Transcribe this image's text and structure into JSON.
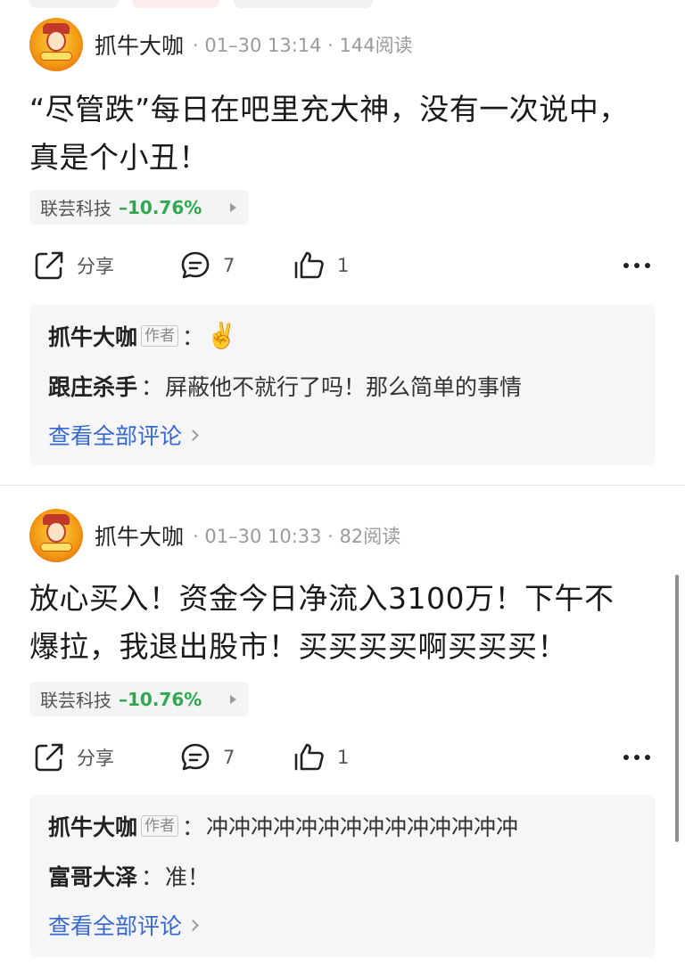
{
  "posts": [
    {
      "author": "抓牛大咖",
      "meta": "· 01–30 13:14 · 144阅读",
      "content_lines": [
        "“尽管跌”每日在吧里充大神，没有一次说中，",
        "真是个小丑！"
      ],
      "stock": {
        "name": "联芸科技",
        "change": "–10.76%"
      },
      "actions": {
        "share_label": "分享",
        "comment_count": "7",
        "like_count": "1"
      },
      "comments": [
        {
          "author": "抓牛大咖",
          "badge": "作者",
          "text": "✌️"
        },
        {
          "author": "跟庄杀手",
          "text": "屏蔽他不就行了吗！那么简单的事情"
        }
      ],
      "view_all": "查看全部评论"
    },
    {
      "author": "抓牛大咖",
      "meta": "· 01–30 10:33 · 82阅读",
      "content_lines": [
        "放心买入！资金今日净流入3100万！下午不",
        "爆拉，我退出股市！买买买买啊买买买！"
      ],
      "stock": {
        "name": "联芸科技",
        "change": "–10.76%"
      },
      "actions": {
        "share_label": "分享",
        "comment_count": "7",
        "like_count": "1"
      },
      "comments": [
        {
          "author": "抓牛大咖",
          "badge": "作者",
          "text": "冲冲冲冲冲冲冲冲冲冲冲冲冲冲"
        },
        {
          "author": "富哥大泽",
          "text": "准！"
        }
      ],
      "view_all": "查看全部评论"
    }
  ],
  "colors": {
    "down": "#2fa84f",
    "link": "#3569cf"
  },
  "icons": [
    "avatar",
    "share-icon",
    "comment-icon",
    "like-icon",
    "more-icon",
    "chevron-right-icon"
  ]
}
